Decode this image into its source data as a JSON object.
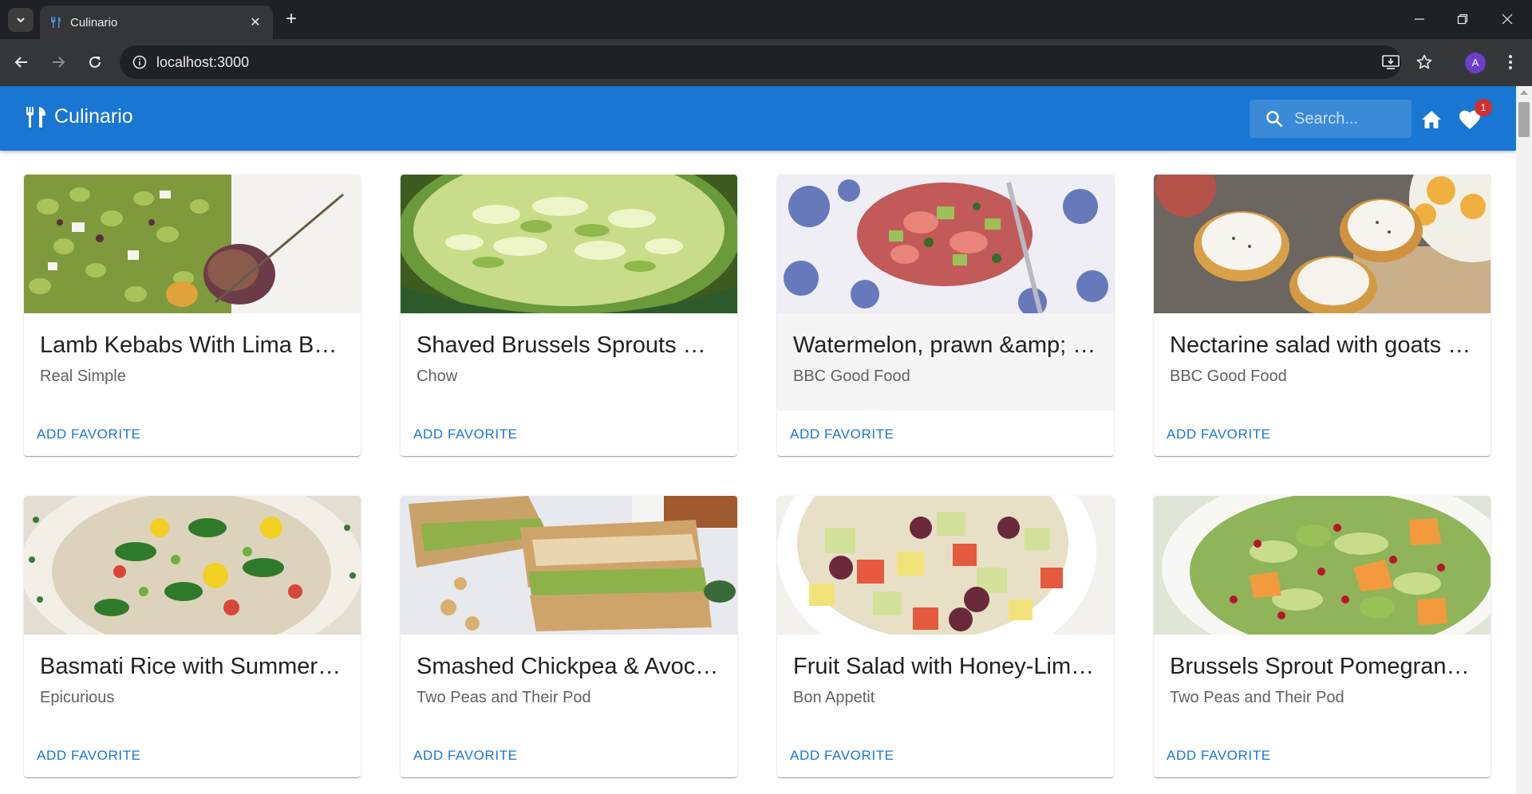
{
  "browser": {
    "tab_title": "Culinario",
    "url": "localhost:3000"
  },
  "appbar": {
    "title": "Culinario",
    "search_placeholder": "Search...",
    "favorites_count": "1"
  },
  "colors": {
    "primary": "#1976d2",
    "badge": "#d32f2f"
  },
  "recipes": [
    {
      "title": "Lamb Kebabs With Lima Beans",
      "source": "Real Simple",
      "action": "ADD FAVORITE"
    },
    {
      "title": "Shaved Brussels Sprouts Salad",
      "source": "Chow",
      "action": "ADD FAVORITE"
    },
    {
      "title": "Watermelon, prawn &amp; avocado salad",
      "source": "BBC Good Food",
      "action": "ADD FAVORITE"
    },
    {
      "title": "Nectarine salad with goats cheese crostini",
      "source": "BBC Good Food",
      "action": "ADD FAVORITE"
    },
    {
      "title": "Basmati Rice with Summer Vegetables",
      "source": "Epicurious",
      "action": "ADD FAVORITE"
    },
    {
      "title": "Smashed Chickpea & Avocado Salad Sandwich",
      "source": "Two Peas and Their Pod",
      "action": "ADD FAVORITE"
    },
    {
      "title": "Fruit Salad with Honey-Lime Dressing",
      "source": "Bon Appetit",
      "action": "ADD FAVORITE"
    },
    {
      "title": "Brussels Sprout Pomegranate Salad",
      "source": "Two Peas and Their Pod",
      "action": "ADD FAVORITE"
    }
  ]
}
